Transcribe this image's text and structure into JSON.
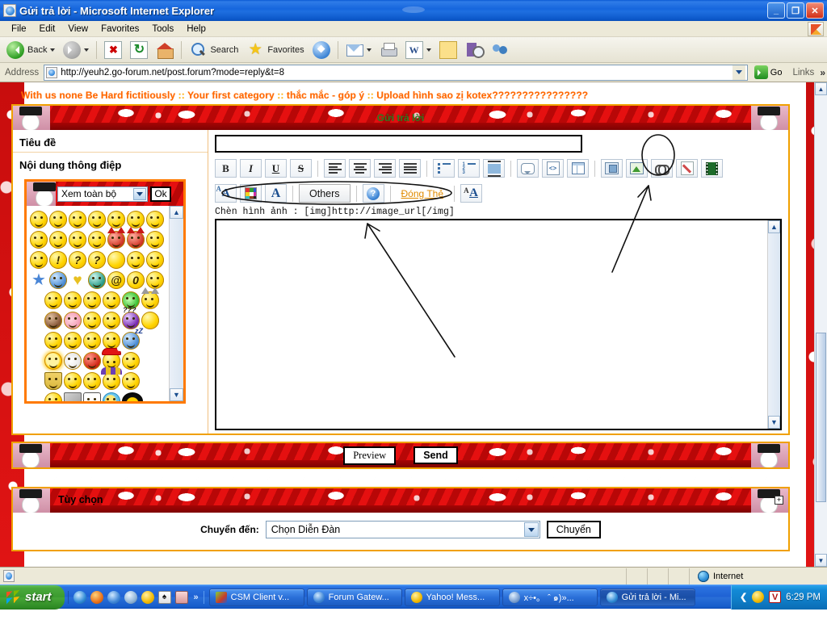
{
  "window": {
    "title": "Gửi trả lời - Microsoft Internet Explorer",
    "minimize_label": "_",
    "restore_label": "❐",
    "close_label": "✕"
  },
  "menubar": {
    "items": [
      "File",
      "Edit",
      "View",
      "Favorites",
      "Tools",
      "Help"
    ]
  },
  "toolbar": {
    "back_label": "Back",
    "search_label": "Search",
    "favorites_label": "Favorites",
    "icons": [
      "back-icon",
      "forward-icon",
      "stop-icon",
      "refresh-icon",
      "home-icon",
      "search-icon",
      "favorites-star-icon",
      "media-icon",
      "mail-icon",
      "print-icon",
      "word-icon",
      "note-icon",
      "edit-icon",
      "messenger-icon"
    ]
  },
  "address": {
    "label": "Address",
    "url": "http://yeuh2.go-forum.net/post.forum?mode=reply&t=8",
    "go_label": "Go",
    "links_label": "Links",
    "chevron": "»"
  },
  "forum": {
    "breadcrumb_parts": [
      "With us none Be Hard fictitiously",
      "Your first category",
      "thắc mắc - góp ý",
      "Upload hình sao zị kotex????????????????"
    ],
    "breadcrumb_sep": "::",
    "post_panel_title": "Gửi trả lời",
    "subject_label": "Tiêu đề",
    "message_label": "Nội dung thông điệp",
    "subject_value": "",
    "smiley": {
      "select_value": "Xem toàn bộ",
      "ok_label": "Ok"
    },
    "editor_toolbar": {
      "bold": "B",
      "italic": "I",
      "underline": "U",
      "strike": "S",
      "others_label": "Others",
      "close_tag_label": "Đóng Thẻ",
      "icons": [
        "bold-icon",
        "italic-icon",
        "underline-icon",
        "strikethrough-icon",
        "align-left-icon",
        "align-center-icon",
        "align-right-icon",
        "align-justify-icon",
        "bullet-list-icon",
        "numbered-list-icon",
        "indent-icon",
        "quote-icon",
        "code-icon",
        "table-icon",
        "insert-image-file-icon",
        "insert-image-icon",
        "insert-link-icon",
        "edit-pen-icon",
        "insert-video-icon",
        "font-face-icon",
        "font-color-icon",
        "font-size-icon",
        "help-icon",
        "text-style-icon"
      ]
    },
    "image_hint": "Chèn hình ảnh : [img]http://image_url[/img]",
    "message_value": "",
    "preview_label": "Preview",
    "send_label": "Send",
    "options": {
      "title": "Tùy chọn",
      "expand_label": "+",
      "jump_label": "Chuyển đến:",
      "jump_value": "Chọn Diễn Đàn",
      "jump_button": "Chuyển"
    }
  },
  "statusbar": {
    "zone": "Internet"
  },
  "taskbar": {
    "start_label": "start",
    "quicklaunch_icons": [
      "internet-explorer-icon",
      "firefox-icon",
      "browser-icon",
      "media-player-icon",
      "yahoo-messenger-icon",
      "cards-icon",
      "calculator-icon"
    ],
    "quicklaunch_chevron": "»",
    "tasks": [
      {
        "label": "CSM Client v...",
        "icon": "csm-client-icon",
        "active": false
      },
      {
        "label": "Forum Gatew...",
        "icon": "forum-gateway-icon",
        "active": false
      },
      {
        "label": "Yahoo! Mess...",
        "icon": "yahoo-messenger-icon",
        "active": false
      },
      {
        "label": "x÷•。 ˆ  ๑)»...",
        "icon": "chat-window-icon",
        "active": false
      },
      {
        "label": "Gửi trả lời - Mi...",
        "icon": "internet-explorer-icon",
        "active": true
      }
    ],
    "tray_chevron": "❮",
    "tray_icons": [
      "yahoo-messenger-tray-icon",
      "volume-tray-icon"
    ],
    "tray_v_label": "V",
    "clock": "6:29 PM"
  }
}
